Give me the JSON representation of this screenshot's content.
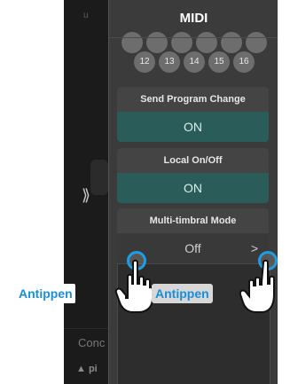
{
  "panel": {
    "title": "MIDI"
  },
  "channels_visible": [
    "12",
    "13",
    "14",
    "15",
    "16"
  ],
  "settings": [
    {
      "label": "Send Program Change",
      "value": "ON"
    },
    {
      "label": "Local On/Off",
      "value": "ON"
    },
    {
      "label": "Multi-timbral Mode",
      "value": "Off"
    }
  ],
  "background_screen": {
    "chevron": "⟫",
    "concert_text": "Conc",
    "pi_text": "pi"
  },
  "annotations": {
    "tap_label_1": "Antippen",
    "tap_label_2": "Antippen"
  },
  "colors": {
    "accent_on": "#2a5d5a",
    "tap_ring": "#1e9de2",
    "label_text": "#1a8fd8"
  }
}
